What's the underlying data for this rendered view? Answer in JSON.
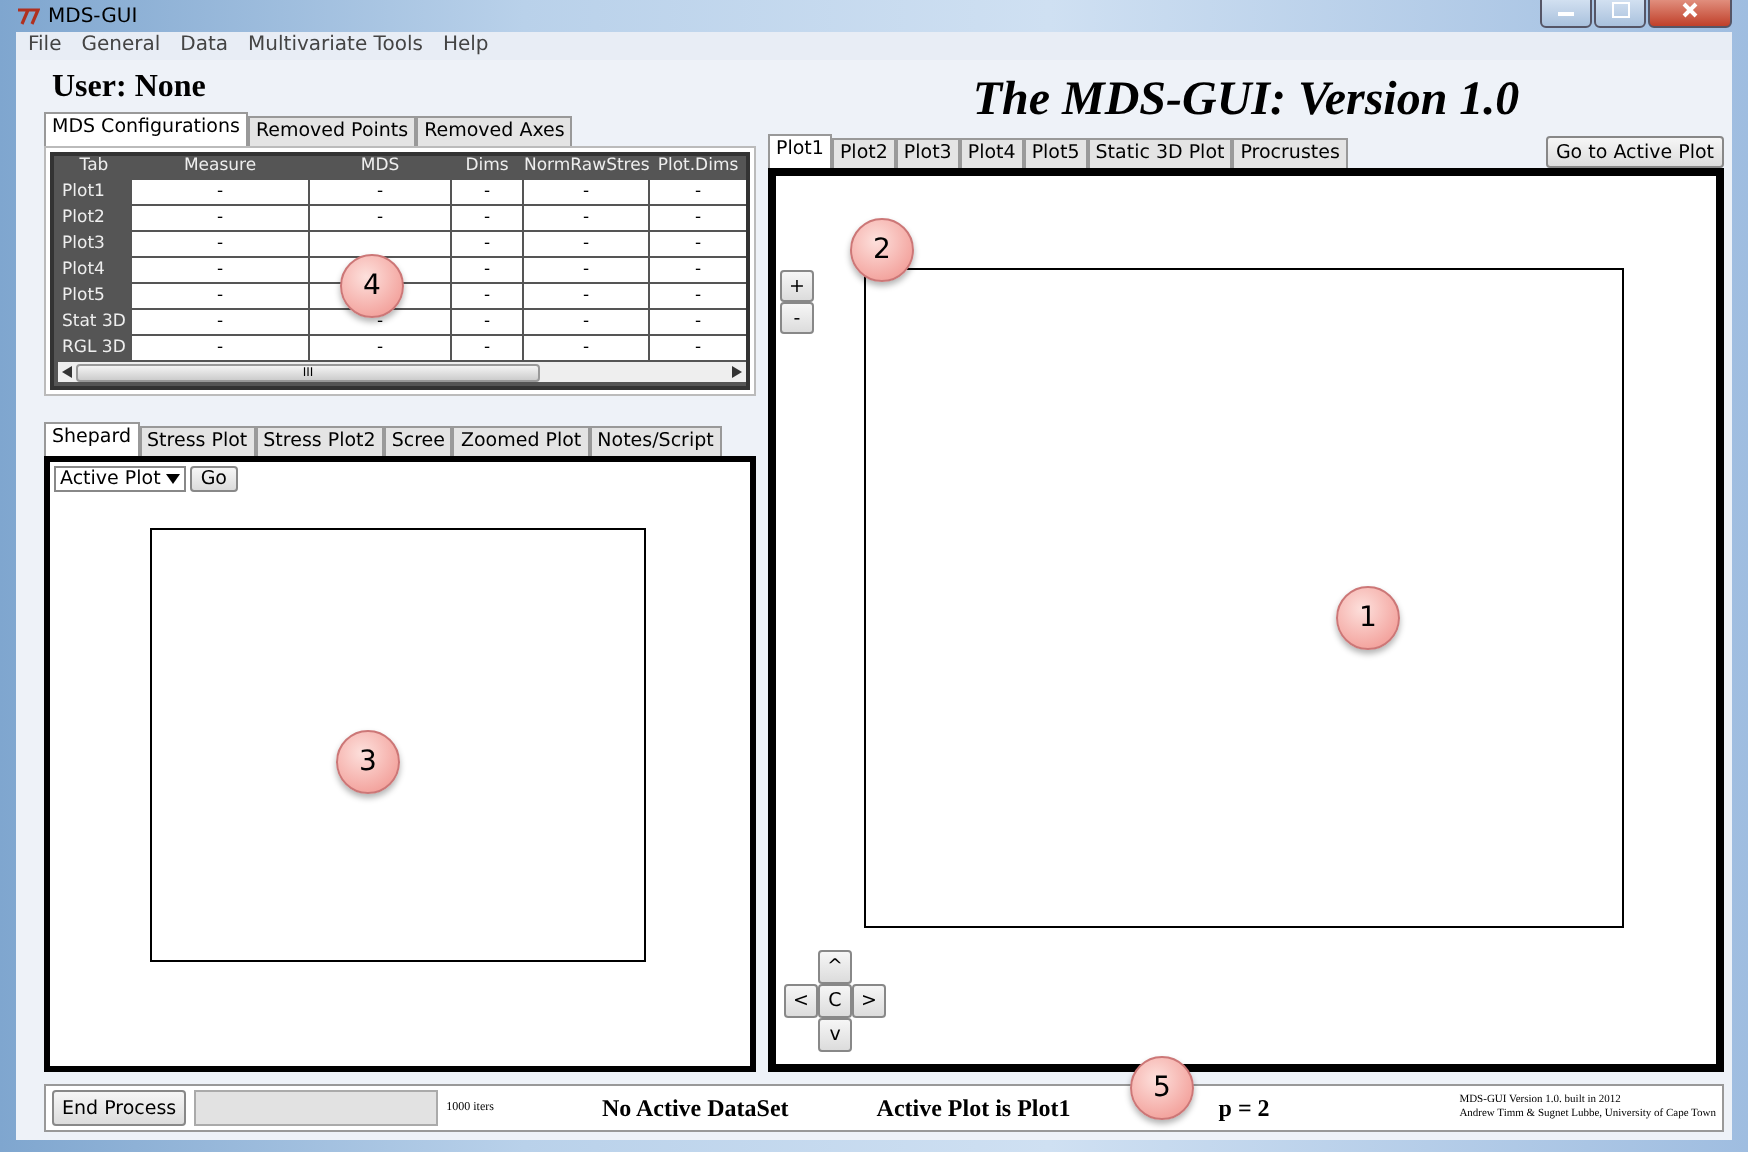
{
  "window": {
    "title": "MDS-GUI"
  },
  "menu": [
    "File",
    "General",
    "Data",
    "Multivariate Tools",
    "Help"
  ],
  "user_label": "User:  None",
  "app_title": "The MDS-GUI: Version 1.0",
  "config_tabs": [
    {
      "label": "MDS Configurations",
      "selected": true
    },
    {
      "label": "Removed Points",
      "selected": false
    },
    {
      "label": "Removed Axes",
      "selected": false
    }
  ],
  "config_table": {
    "columns": [
      "Tab",
      "Measure",
      "MDS",
      "Dims",
      "NormRawStres",
      "Plot.Dims"
    ],
    "rows": [
      [
        "Plot1",
        "-",
        "-",
        "-",
        "-",
        "-"
      ],
      [
        "Plot2",
        "-",
        "-",
        "-",
        "-",
        "-"
      ],
      [
        "Plot3",
        "-",
        null,
        "-",
        "-",
        "-"
      ],
      [
        "Plot4",
        "-",
        null,
        "-",
        "-",
        "-"
      ],
      [
        "Plot5",
        "-",
        null,
        "-",
        "-",
        "-"
      ],
      [
        "Stat 3D",
        "-",
        "-",
        "-",
        "-",
        "-"
      ],
      [
        "RGL 3D",
        "-",
        "-",
        "-",
        "-",
        "-"
      ]
    ],
    "scroll_grip": "III"
  },
  "diag_tabs": [
    {
      "label": "Shepard",
      "selected": true
    },
    {
      "label": "Stress Plot",
      "selected": false
    },
    {
      "label": "Stress Plot2",
      "selected": false
    },
    {
      "label": "Scree",
      "selected": false
    },
    {
      "label": "Zoomed Plot",
      "selected": false
    },
    {
      "label": "Notes/Script",
      "selected": false
    }
  ],
  "diag_select": {
    "value": "Active Plot"
  },
  "diag_go": "Go",
  "plot_tabs": [
    {
      "label": "Plot1",
      "selected": true
    },
    {
      "label": "Plot2",
      "selected": false
    },
    {
      "label": "Plot3",
      "selected": false
    },
    {
      "label": "Plot4",
      "selected": false
    },
    {
      "label": "Plot5",
      "selected": false
    },
    {
      "label": "Static 3D Plot",
      "selected": false
    },
    {
      "label": "Procrustes",
      "selected": false
    }
  ],
  "go_active_button": "Go to Active Plot",
  "zoom_buttons": [
    "+",
    "-"
  ],
  "nav_buttons": {
    "up": "^",
    "left": "<",
    "center": "C",
    "right": ">",
    "down": "v"
  },
  "status_bar": {
    "end_button": "End Process",
    "progress": {
      "level": 0
    },
    "iters": "1000 iters",
    "dataset": "No Active DataSet",
    "active_plot": "Active Plot is Plot1",
    "p": "p = 2",
    "credit": [
      "MDS-GUI Version 1.0. built in 2012",
      "Andrew Timm & Sugnet Lubbe, University of Cape Town"
    ]
  },
  "callouts": [
    "1",
    "2",
    "3",
    "4",
    "5"
  ]
}
